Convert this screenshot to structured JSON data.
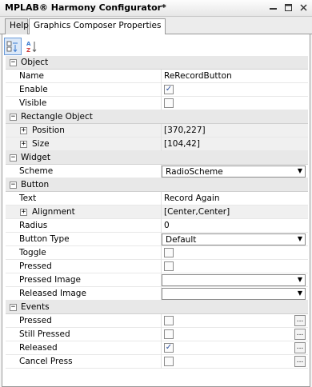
{
  "window": {
    "title": "MPLAB® Harmony Configurator*"
  },
  "tabs": [
    {
      "label": "Help"
    },
    {
      "label": "Graphics Composer Properties"
    }
  ],
  "toolbar": {
    "categorized_icon": "categorized-sort-icon",
    "alphabetical_icon": "alphabetical-sort-icon"
  },
  "categories": {
    "object": "Object",
    "rectangle": "Rectangle Object",
    "widget": "Widget",
    "button": "Button",
    "events": "Events"
  },
  "props": {
    "name": {
      "label": "Name",
      "value": "ReRecordButton"
    },
    "enable": {
      "label": "Enable",
      "checked": true
    },
    "visible": {
      "label": "Visible",
      "checked": false
    },
    "position": {
      "label": "Position",
      "value": "[370,227]"
    },
    "size": {
      "label": "Size",
      "value": "[104,42]"
    },
    "scheme": {
      "label": "Scheme",
      "value": "RadioScheme"
    },
    "text": {
      "label": "Text",
      "value": "Record Again"
    },
    "alignment": {
      "label": "Alignment",
      "value": "[Center,Center]"
    },
    "radius": {
      "label": "Radius",
      "value": "0"
    },
    "button_type": {
      "label": "Button Type",
      "value": "Default"
    },
    "toggle": {
      "label": "Toggle",
      "checked": false
    },
    "pressed": {
      "label": "Pressed",
      "checked": false
    },
    "pressed_image": {
      "label": "Pressed Image",
      "value": ""
    },
    "released_image": {
      "label": "Released Image",
      "value": ""
    },
    "ev_pressed": {
      "label": "Pressed",
      "checked": false
    },
    "ev_still": {
      "label": "Still Pressed",
      "checked": false
    },
    "ev_released": {
      "label": "Released",
      "checked": true
    },
    "ev_cancel": {
      "label": "Cancel Press",
      "checked": false
    }
  },
  "symbols": {
    "collapse": "−",
    "expand": "+",
    "ellipsis": "...",
    "check": "✓"
  }
}
